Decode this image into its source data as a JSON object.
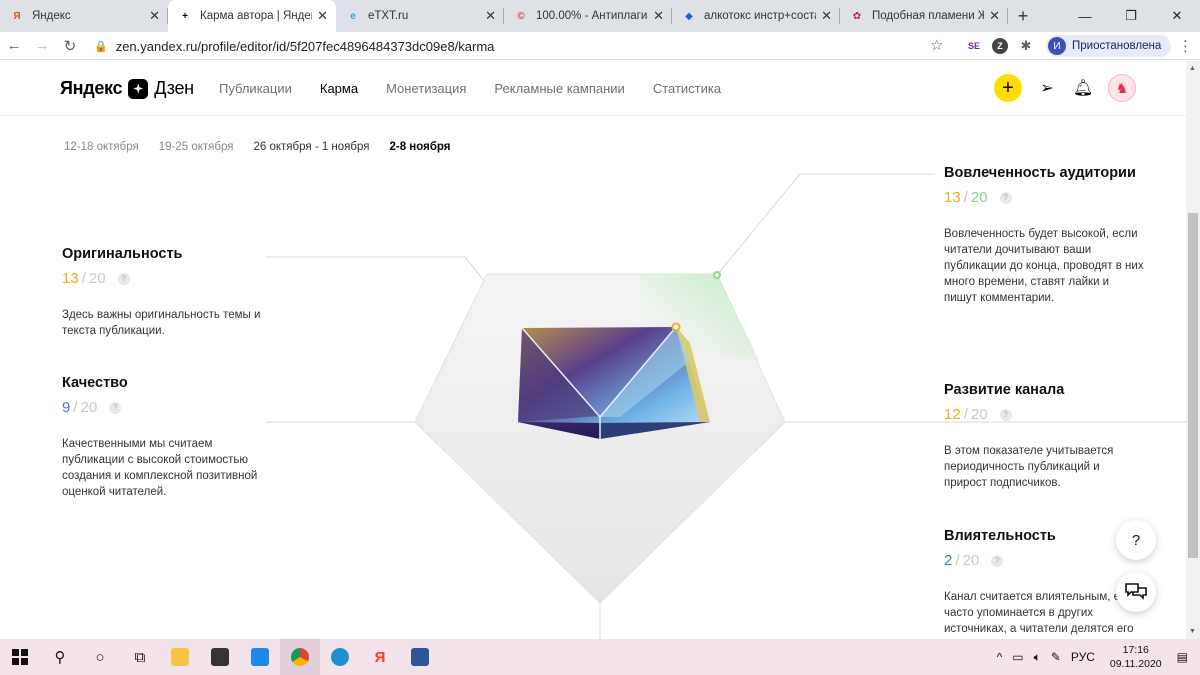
{
  "browser": {
    "tabs": [
      {
        "title": "Яндекс",
        "fav": "Я",
        "fav_color": "#fc3f1d",
        "active": false
      },
      {
        "title": "Карма автора | Яндекс",
        "fav": "+",
        "fav_color": "#000000",
        "active": true
      },
      {
        "title": "eTXT.ru",
        "fav": "e",
        "fav_color": "#2aa8e0",
        "active": false
      },
      {
        "title": "100.00% - Антиплагиат",
        "fav": "©",
        "fav_color": "#e53935",
        "active": false
      },
      {
        "title": "алкотокс инстр+соста",
        "fav": "◆",
        "fav_color": "#1e5bd8",
        "active": false
      },
      {
        "title": "Подобная пламени Ж",
        "fav": "✿",
        "fav_color": "#c2185b",
        "active": false
      }
    ],
    "new_tab_icon": "+",
    "url": "zen.yandex.ru/profile/editor/id/5f207fec4896484373dc09e8/karma",
    "profile_initial": "И",
    "profile_status": "Приостановлена"
  },
  "zen": {
    "logo_yandex": "Яндекс",
    "logo_dzen": "Дзен",
    "nav": [
      {
        "label": "Публикации",
        "active": false
      },
      {
        "label": "Карма",
        "active": true
      },
      {
        "label": "Монетизация",
        "active": false
      },
      {
        "label": "Рекламные кампании",
        "active": false
      },
      {
        "label": "Статистика",
        "active": false
      }
    ]
  },
  "weeks": [
    {
      "label": "12-18 октября",
      "state": "past"
    },
    {
      "label": "19-25 октября",
      "state": "past"
    },
    {
      "label": "26 октября - 1 ноября",
      "state": "mid"
    },
    {
      "label": "2-8 ноября",
      "state": "current"
    }
  ],
  "metrics": {
    "originality": {
      "title": "Оригинальность",
      "score": "13",
      "max": "20",
      "color": "#f5a623",
      "text": "Здесь важны оригинальность темы и текста публикации."
    },
    "quality": {
      "title": "Качество",
      "score": "9",
      "max": "20",
      "color": "#4a6fd6",
      "text": "Качественными мы считаем публикации с высокой стоимостью создания и комплексной позитивной оценкой читателей."
    },
    "engagement": {
      "title": "Вовлеченность аудитории",
      "score": "13",
      "max": "20",
      "color": "#f5a623",
      "text": "Вовлеченность будет высокой, если читатели дочитывают ваши публикации до конца, проводят в них много времени, ставят лайки и пишут комментарии."
    },
    "growth": {
      "title": "Развитие канала",
      "score": "12",
      "max": "20",
      "color": "#f5a623",
      "text": "В этом показателе учитывается периодичность публикаций и прирост подписчиков."
    },
    "influence": {
      "title": "Влиятельность",
      "score": "2",
      "max": "20",
      "color": "#4a6fd6",
      "text": "Канал считается влиятельным, е он часто упоминается в других источниках, а читатели делятся его"
    }
  },
  "help_fab": "?",
  "taskbar": {
    "lang": "РУС",
    "time": "17:16",
    "date": "09.11.2020"
  }
}
